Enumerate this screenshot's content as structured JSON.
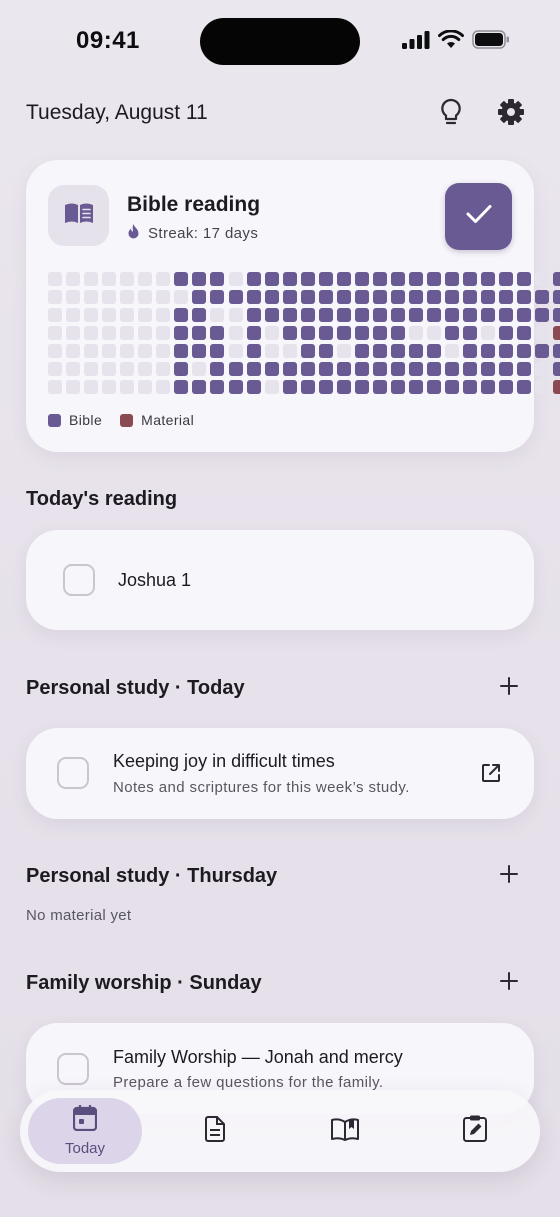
{
  "status_bar": {
    "time": "09:41",
    "signal_icon": "cellular-signal-icon",
    "wifi_icon": "wifi-icon",
    "battery_icon": "battery-icon"
  },
  "header": {
    "date": "Tuesday, August 11",
    "tip_icon": "lightbulb-icon",
    "settings_icon": "gear-icon"
  },
  "streak_card": {
    "title": "Bible reading",
    "streak_text": "Streak: 17 days",
    "streak_icon": "flame-icon",
    "book_icon": "book-icon",
    "done_icon": "checkmark-icon",
    "legend": [
      {
        "label": "Bible",
        "color": "#6a5a94"
      },
      {
        "label": "Material",
        "color": "#8a4a52"
      }
    ],
    "colors": {
      "empty": "#e6e3ec",
      "bible": "#6a5a94",
      "material": "#8a4a52"
    },
    "heatmap": [
      "000000011101111111111111111011",
      "000000001111111111111111111111",
      "000000011001111111111111111110",
      "000000011101011111110011011020",
      "000000011101001101111101111110",
      "000000010111111111111111111010",
      "000000011111011111111111111020"
    ]
  },
  "todays_reading": {
    "title": "Today's reading",
    "items": [
      {
        "label": "Joshua 1"
      }
    ]
  },
  "personal_study_today": {
    "title": "Personal study · Today",
    "items": [
      {
        "title": "Keeping joy in difficult times",
        "subtitle": "Notes and scriptures for this week’s study.",
        "open_icon": "external-link-icon"
      }
    ]
  },
  "personal_study_thursday": {
    "title": "Personal study · Thursday",
    "empty_text": "No material yet"
  },
  "family_worship": {
    "title": "Family worship · Sunday",
    "items": [
      {
        "title": "Family Worship — Jonah and mercy",
        "subtitle": "Prepare a few questions for the family."
      }
    ]
  },
  "tab_bar": {
    "tabs": [
      {
        "label": "Today",
        "icon": "calendar-icon",
        "active": true
      },
      {
        "label": "",
        "icon": "document-icon",
        "active": false
      },
      {
        "label": "",
        "icon": "open-book-icon",
        "active": false
      },
      {
        "label": "",
        "icon": "clipboard-edit-icon",
        "active": false
      }
    ]
  }
}
